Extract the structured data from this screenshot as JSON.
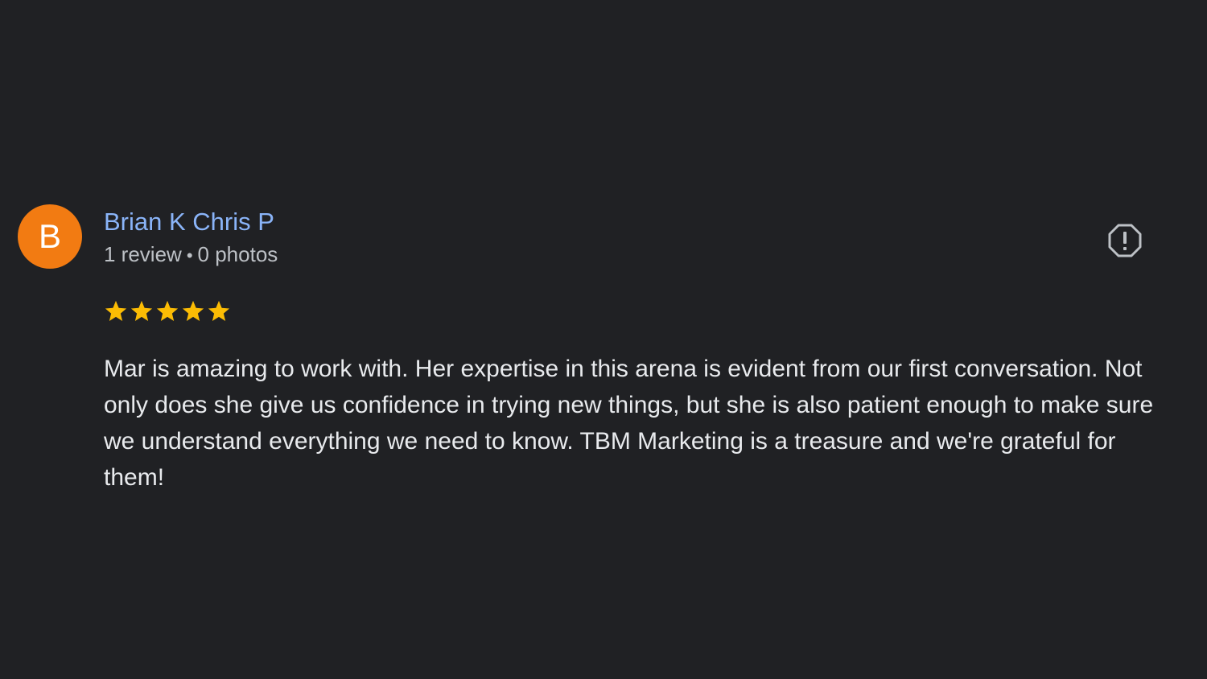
{
  "review": {
    "avatar_initial": "B",
    "avatar_color": "#f27b12",
    "author_name": "Brian K Chris P",
    "review_count": "1 review",
    "separator": "•",
    "photo_count": "0 photos",
    "rating": 5,
    "rating_max": 5,
    "star_color": "#fbbc04",
    "text": "Mar is amazing to work with. Her expertise in this arena is evident from our first conversation. Not only does she give us confidence in trying new things, but she is also patient enough to make sure we understand everything we need to know. TBM Marketing is a treasure and we're grateful for them!",
    "report_icon": "report-flag-icon"
  },
  "colors": {
    "background": "#202124",
    "author_link": "#8ab4f8",
    "secondary_text": "#bdc1c6",
    "body_text": "#e8eaed"
  }
}
